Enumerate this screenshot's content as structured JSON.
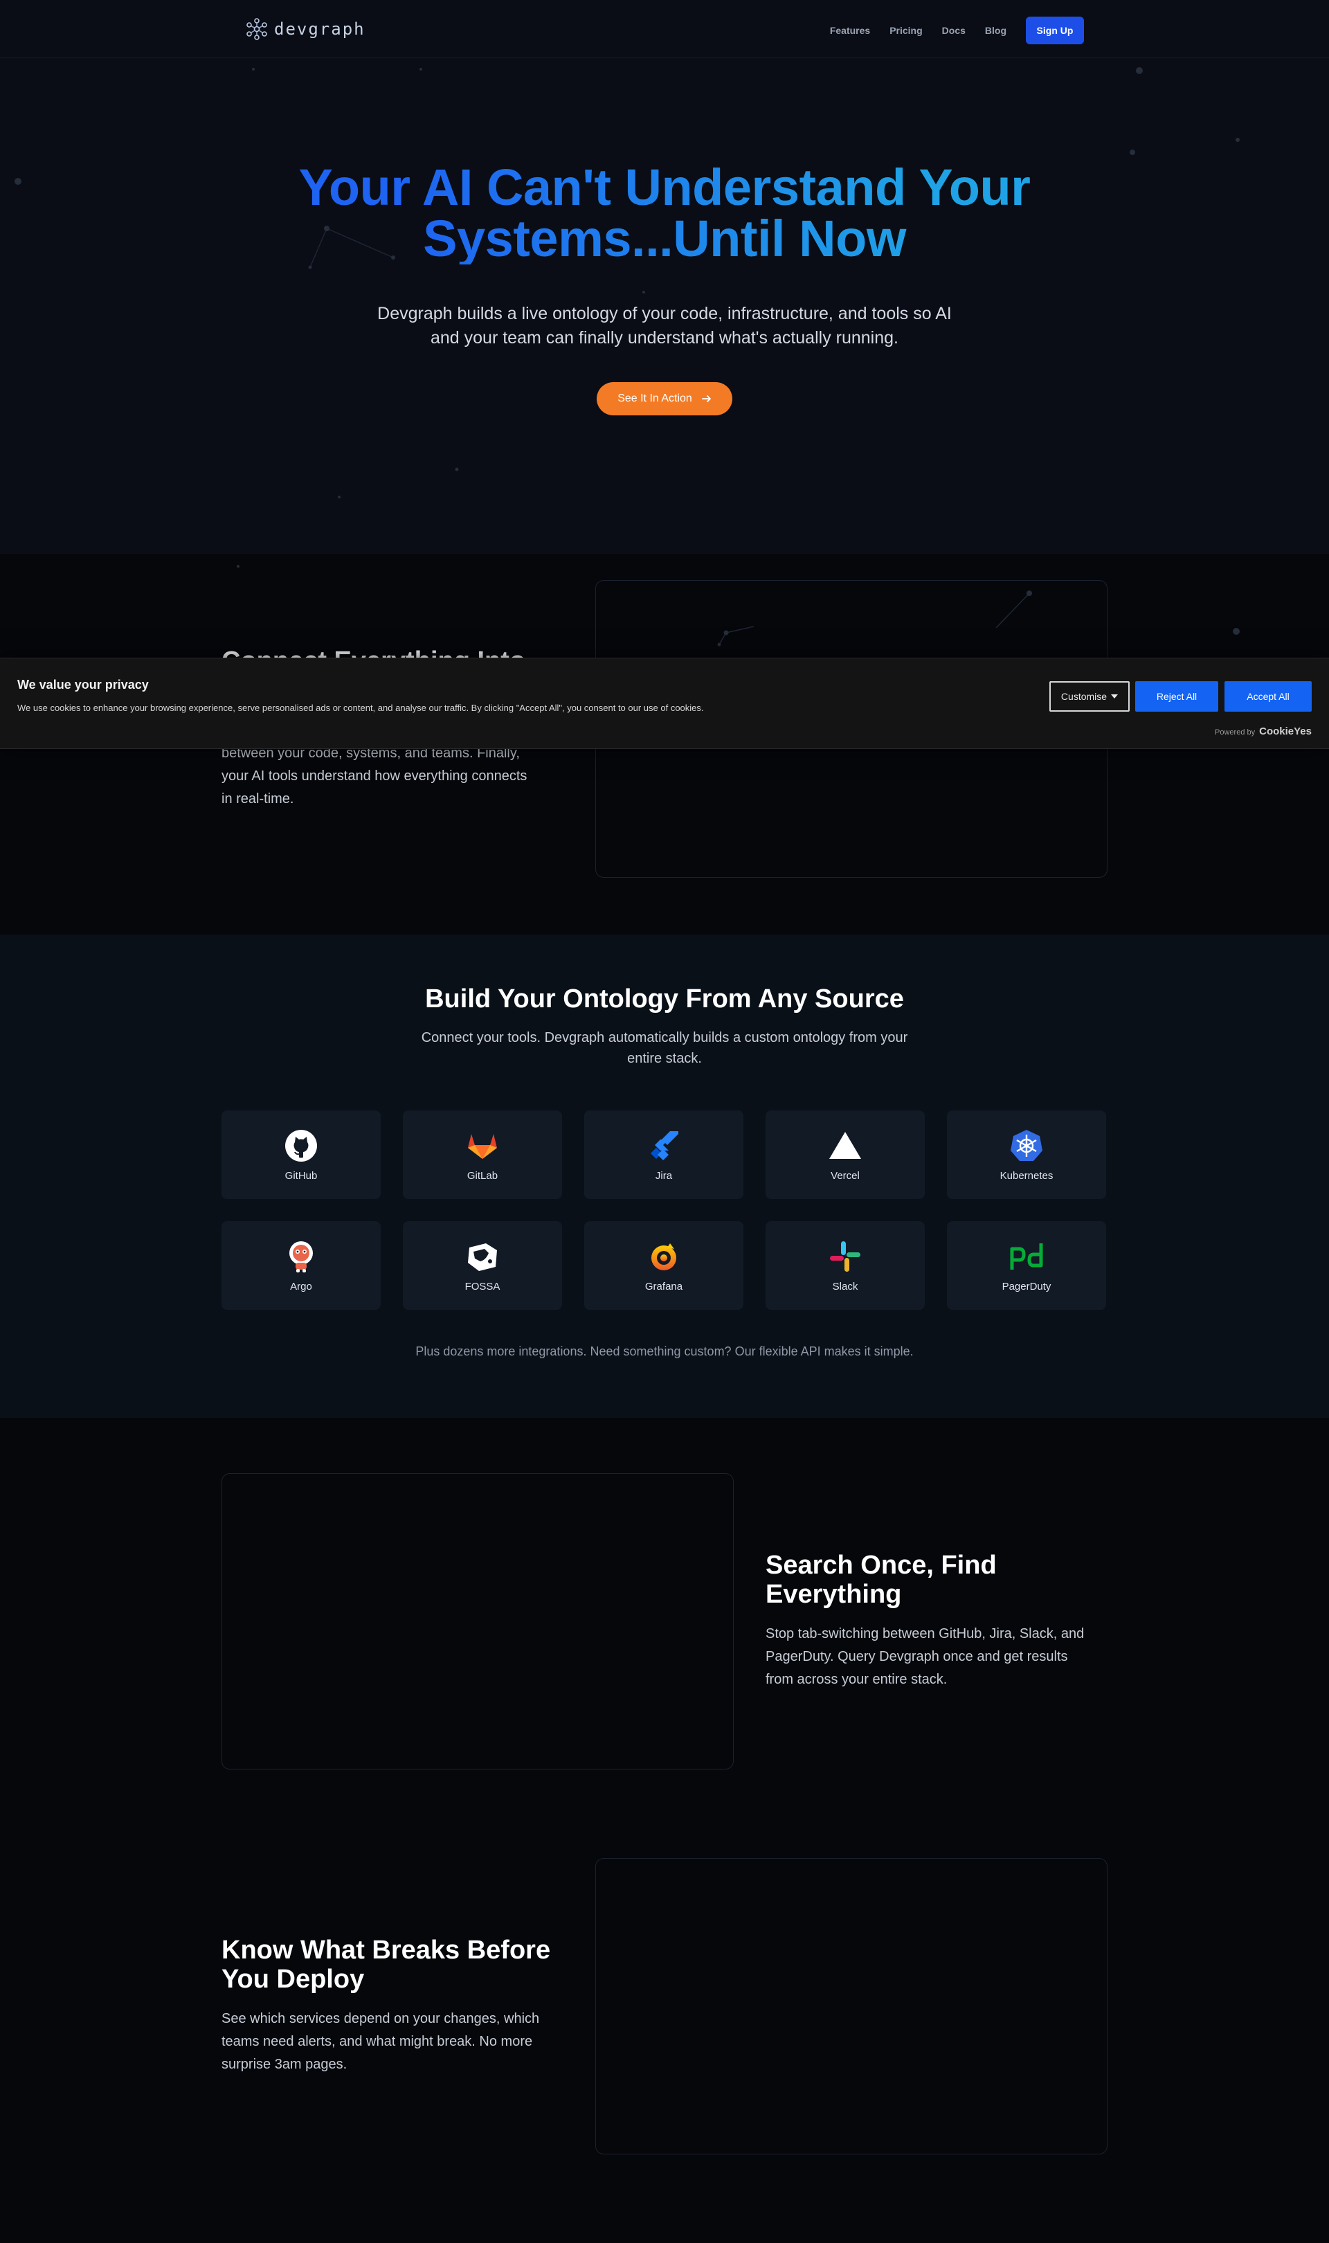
{
  "nav": {
    "logo_text": "devgraph",
    "links": [
      "Features",
      "Pricing",
      "Docs",
      "Blog"
    ],
    "signup_label": "Sign Up"
  },
  "hero": {
    "title_line1": "Your AI Can't Understand Your",
    "title_line2": "Systems...Until Now",
    "subtitle_line1": "Devgraph builds a live ontology of your code, infrastructure, and tools so AI",
    "subtitle_line2": "and your team can finally understand what's actually running.",
    "cta_label": "See It In Action",
    "cta_icon": "arrow-right-icon"
  },
  "connect": {
    "title": "Connect Everything Into",
    "text_lines": [
      "between your code, systems, and teams. Finally,",
      "your AI tools understand how everything connects",
      "in real-time."
    ]
  },
  "cookie": {
    "title": "We value your privacy",
    "text": "We use cookies to enhance your browsing experience, serve personalised ads or content, and analyse our traffic. By clicking \"Accept All\", you consent to our use of cookies.",
    "customise_label": "Customise",
    "reject_label": "Reject All",
    "accept_label": "Accept All",
    "powered_by": "Powered by",
    "powered_brand": "CookieYes"
  },
  "sources": {
    "title": "Build Your Ontology From Any Source",
    "subtitle_line1": "Connect your tools. Devgraph automatically builds a custom ontology from your",
    "subtitle_line2": "entire stack.",
    "integrations": [
      {
        "name": "GitHub",
        "icon": "github-icon"
      },
      {
        "name": "GitLab",
        "icon": "gitlab-icon"
      },
      {
        "name": "Jira",
        "icon": "jira-icon"
      },
      {
        "name": "Vercel",
        "icon": "vercel-icon"
      },
      {
        "name": "Kubernetes",
        "icon": "kubernetes-icon"
      },
      {
        "name": "Argo",
        "icon": "argo-icon"
      },
      {
        "name": "FOSSA",
        "icon": "fossa-icon"
      },
      {
        "name": "Grafana",
        "icon": "grafana-icon"
      },
      {
        "name": "Slack",
        "icon": "slack-icon"
      },
      {
        "name": "PagerDuty",
        "icon": "pagerduty-icon"
      }
    ],
    "footnote": "Plus dozens more integrations. Need something custom? Our flexible API makes it simple."
  },
  "search": {
    "title_line1": "Search Once, Find",
    "title_line2": "Everything",
    "text_lines": [
      "Stop tab-switching between GitHub, Jira, Slack, and",
      "PagerDuty. Query Devgraph once and get results",
      "from across your entire stack."
    ]
  },
  "deploy": {
    "title_line1": "Know What Breaks Before",
    "title_line2": "You Deploy",
    "text_lines": [
      "See which services depend on your changes, which",
      "teams need alerts, and what might break. No more",
      "surprise 3am pages."
    ]
  },
  "colors": {
    "accent_blue": "#1d4fe8",
    "cta_orange": "#f47b25",
    "cookie_blue": "#1463f3"
  }
}
